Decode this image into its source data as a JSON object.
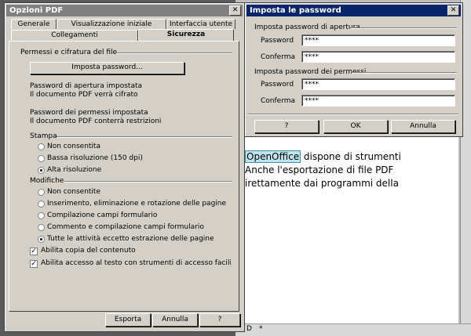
{
  "background": {
    "doc_paragraph_highlight": "OpenOffice",
    "doc_lines": [
      " dispone di strumenti",
      "Anche l'esportazione di file PDF",
      "irettamente dai programmi della"
    ],
    "status_frag1": "D",
    "status_frag2": "*"
  },
  "pdf_dialog": {
    "title": "Opzioni PDF",
    "tabs": [
      "Generale",
      "Visualizzazione iniziale",
      "Interfaccia utente",
      "Collegamenti",
      "Sicurezza"
    ],
    "group_permissions": "Permessi e cifratura del file",
    "set_password_btn": "Imposta password...",
    "open_pw_status_1": "Password di apertura impostata",
    "open_pw_status_2": "Il documento PDF verrà cifrato",
    "perm_pw_status_1": "Password dei permessi impostata",
    "perm_pw_status_2": "Il documento PDF conterrà restrizioni",
    "group_print": "Stampa",
    "print_options": [
      "Non consentita",
      "Bassa risoluzione (150 dpi)",
      "Alta risoluzione"
    ],
    "print_selected": 2,
    "group_changes": "Modifiche",
    "change_options": [
      "Non consentite",
      "Inserimento, eliminazione e rotazione delle pagine",
      "Compilazione campi formulario",
      "Commento e compilazione campi formulario",
      "Tutte le attività eccetto estrazione delle pagine"
    ],
    "change_selected": 4,
    "check_copy": "Abilita copia del contenuto",
    "check_access": "Abilita accesso al testo con strumenti di accesso facilitato",
    "btn_export": "Esporta",
    "btn_cancel": "Annulla",
    "btn_help": "?"
  },
  "pw_dialog": {
    "title": "Imposta le password",
    "group_open": "Imposta password di apertura",
    "label_password": "Password",
    "label_confirm": "Conferma",
    "open_password": "****",
    "open_confirm": "****",
    "group_perm": "Imposta password dei permessi",
    "perm_password": "****",
    "perm_confirm": "****",
    "btn_help": "?",
    "btn_ok": "OK",
    "btn_cancel": "Annulla"
  }
}
